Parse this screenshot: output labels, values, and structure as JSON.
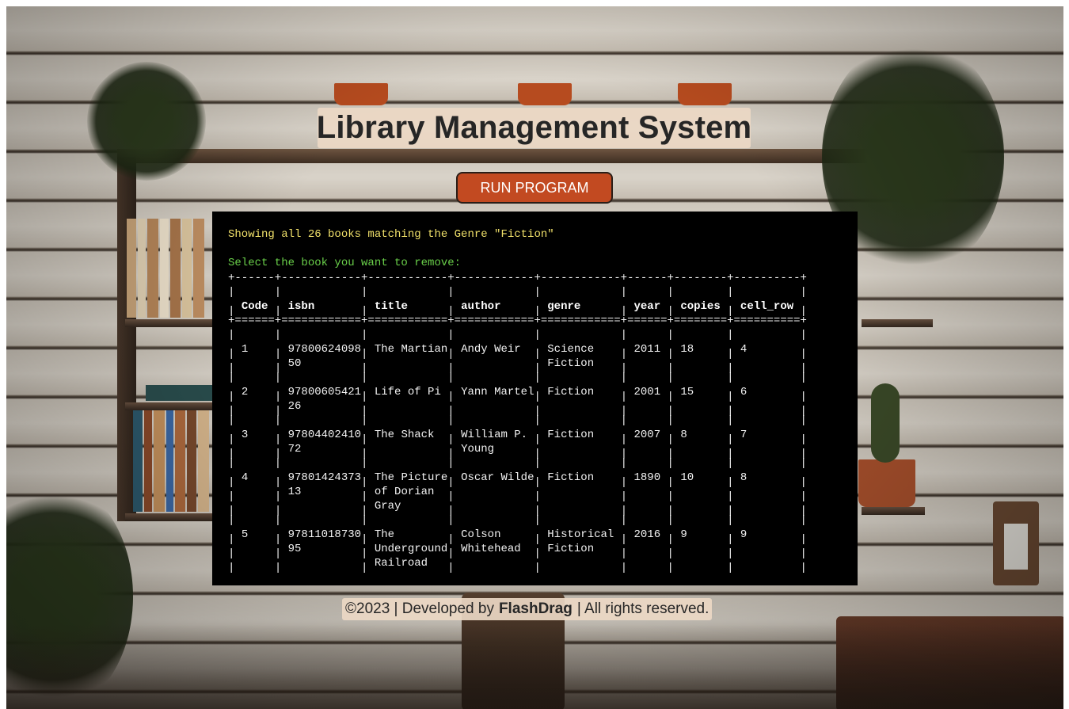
{
  "page": {
    "title": "Library Management System",
    "run_button": "RUN PROGRAM"
  },
  "terminal": {
    "message": "Showing all 26 books matching the Genre \"Fiction\"",
    "prompt": "Select the book you want to remove:",
    "columns": [
      "Code",
      "isbn",
      "title",
      "author",
      "genre",
      "year",
      "copies",
      "cell_row"
    ],
    "rows": [
      [
        [
          "1"
        ],
        [
          "97800624098",
          "50"
        ],
        [
          "The Martian"
        ],
        [
          "Andy Weir"
        ],
        [
          "Science",
          "Fiction"
        ],
        [
          "2011"
        ],
        [
          "18"
        ],
        [
          "4"
        ]
      ],
      [
        [
          "2"
        ],
        [
          "97800605421",
          "26"
        ],
        [
          "Life of Pi"
        ],
        [
          "Yann Martel"
        ],
        [
          "Fiction"
        ],
        [
          "2001"
        ],
        [
          "15"
        ],
        [
          "6"
        ]
      ],
      [
        [
          "3"
        ],
        [
          "97804402410",
          "72"
        ],
        [
          "The Shack"
        ],
        [
          "William P.",
          "Young"
        ],
        [
          "Fiction"
        ],
        [
          "2007"
        ],
        [
          "8"
        ],
        [
          "7"
        ]
      ],
      [
        [
          "4"
        ],
        [
          "97801424373",
          "13"
        ],
        [
          "The Picture",
          "of Dorian",
          "Gray"
        ],
        [
          "Oscar Wilde"
        ],
        [
          "Fiction"
        ],
        [
          "1890"
        ],
        [
          "10"
        ],
        [
          "8"
        ]
      ],
      [
        [
          "5"
        ],
        [
          "97811018730",
          "95"
        ],
        [
          "The",
          "Underground",
          "Railroad"
        ],
        [
          "Colson",
          "Whitehead"
        ],
        [
          "Historical",
          "Fiction"
        ],
        [
          "2016"
        ],
        [
          "9"
        ],
        [
          "9"
        ]
      ]
    ]
  },
  "footer": {
    "prefix": "©2023 | Developed by",
    "brand": "FlashDrag",
    "suffix": "| All rights reserved."
  },
  "colors": {
    "button": "#c24a21",
    "terminal_bg": "#000000",
    "message_text": "#f0e06a",
    "prompt_text": "#6ad04a",
    "label_bg": "#ecd8c4"
  }
}
